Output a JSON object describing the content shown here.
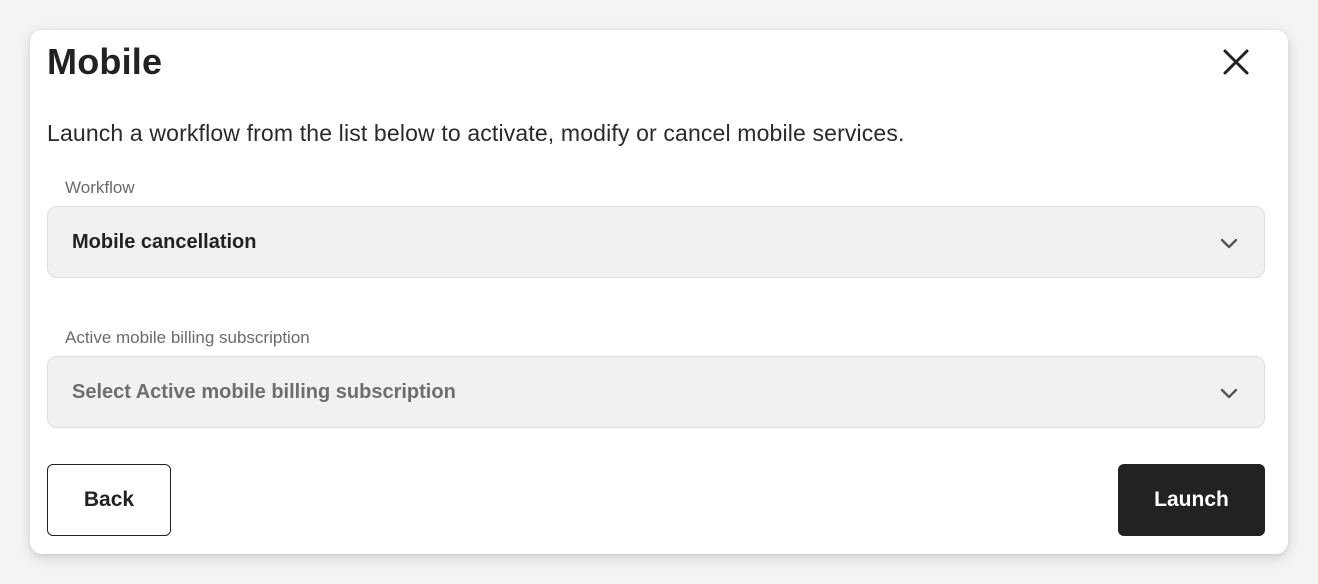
{
  "modal": {
    "title": "Mobile",
    "description": "Launch a workflow from the list below to activate, modify or cancel mobile services."
  },
  "workflow": {
    "label": "Workflow",
    "value": "Mobile cancellation"
  },
  "subscription": {
    "label": "Active mobile billing subscription",
    "placeholder": "Select Active mobile billing subscription"
  },
  "actions": {
    "back_label": "Back",
    "launch_label": "Launch"
  },
  "icons": {
    "close": "close-icon",
    "chevron": "chevron-down-icon"
  },
  "colors": {
    "primary_button": "#222222",
    "select_background": "#f1f1f1",
    "label_text": "#6b6b6b"
  }
}
